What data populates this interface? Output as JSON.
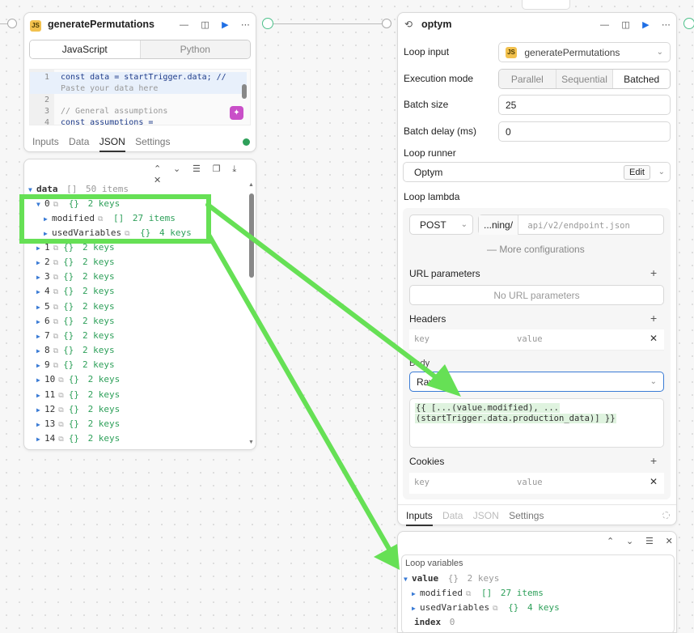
{
  "left_node": {
    "title": "generatePermutations",
    "badge": "JS",
    "lang_tabs": [
      "JavaScript",
      "Python"
    ],
    "code_lines": [
      {
        "num": "1",
        "text": "const data = startTrigger.data; //"
      },
      {
        "num": "",
        "text": "Paste your data here"
      },
      {
        "num": "2",
        "text": ""
      },
      {
        "num": "3",
        "text": "// General assumptions"
      },
      {
        "num": "4",
        "text": "const assumptions ="
      }
    ],
    "bottom_tabs": [
      "Inputs",
      "Data",
      "JSON",
      "Settings"
    ]
  },
  "json_panel": {
    "root_key": "data",
    "root_type": "[]",
    "root_count": "50 items",
    "item0": {
      "key": "0",
      "type": "{}",
      "count": "2 keys"
    },
    "modified": {
      "key": "modified",
      "type": "[]",
      "count": "27 items"
    },
    "usedVariables": {
      "key": "usedVariables",
      "type": "{}",
      "count": "4 keys"
    },
    "rows": [
      {
        "key": "1",
        "count": "2 keys"
      },
      {
        "key": "2",
        "count": "2 keys"
      },
      {
        "key": "3",
        "count": "2 keys"
      },
      {
        "key": "4",
        "count": "2 keys"
      },
      {
        "key": "5",
        "count": "2 keys"
      },
      {
        "key": "6",
        "count": "2 keys"
      },
      {
        "key": "7",
        "count": "2 keys"
      },
      {
        "key": "8",
        "count": "2 keys"
      },
      {
        "key": "9",
        "count": "2 keys"
      },
      {
        "key": "10",
        "count": "2 keys"
      },
      {
        "key": "11",
        "count": "2 keys"
      },
      {
        "key": "12",
        "count": "2 keys"
      },
      {
        "key": "13",
        "count": "2 keys"
      },
      {
        "key": "14",
        "count": "2 keys"
      }
    ]
  },
  "right_node": {
    "title": "optym",
    "loop_input_label": "Loop input",
    "loop_input_value": "generatePermutations",
    "exec_mode_label": "Execution mode",
    "exec_modes": [
      "Parallel",
      "Sequential",
      "Batched"
    ],
    "batch_size_label": "Batch size",
    "batch_size": "25",
    "batch_delay_label": "Batch delay (ms)",
    "batch_delay": "0",
    "loop_runner_label": "Loop runner",
    "loop_runner_value": "Optym",
    "edit_label": "Edit",
    "loop_lambda_label": "Loop lambda",
    "method": "POST",
    "url_prefix": "...ning/",
    "url_placeholder": "api/v2/endpoint.json",
    "more_config": "More configurations",
    "url_params_label": "URL parameters",
    "no_url_params": "No URL parameters",
    "headers_label": "Headers",
    "key_placeholder": "key",
    "value_placeholder": "value",
    "body_label": "Body",
    "body_type": "Raw",
    "body_line1": "{{ [...(value.modified), ...",
    "body_line2": "(startTrigger.data.production_data)] }}",
    "cookies_label": "Cookies",
    "bottom_tabs": [
      "Inputs",
      "Data",
      "JSON",
      "Settings"
    ]
  },
  "loop_vars": {
    "title": "Loop variables",
    "value_key": "value",
    "value_type": "{}",
    "value_count": "2 keys",
    "modified_key": "modified",
    "modified_type": "[]",
    "modified_count": "27 items",
    "used_key": "usedVariables",
    "used_type": "{}",
    "used_count": "4 keys",
    "index_key": "index",
    "index_value": "0"
  },
  "colors": {
    "accent": "#1f6fe5",
    "highlight": "#66e055",
    "green_text": "#2ea05a"
  }
}
